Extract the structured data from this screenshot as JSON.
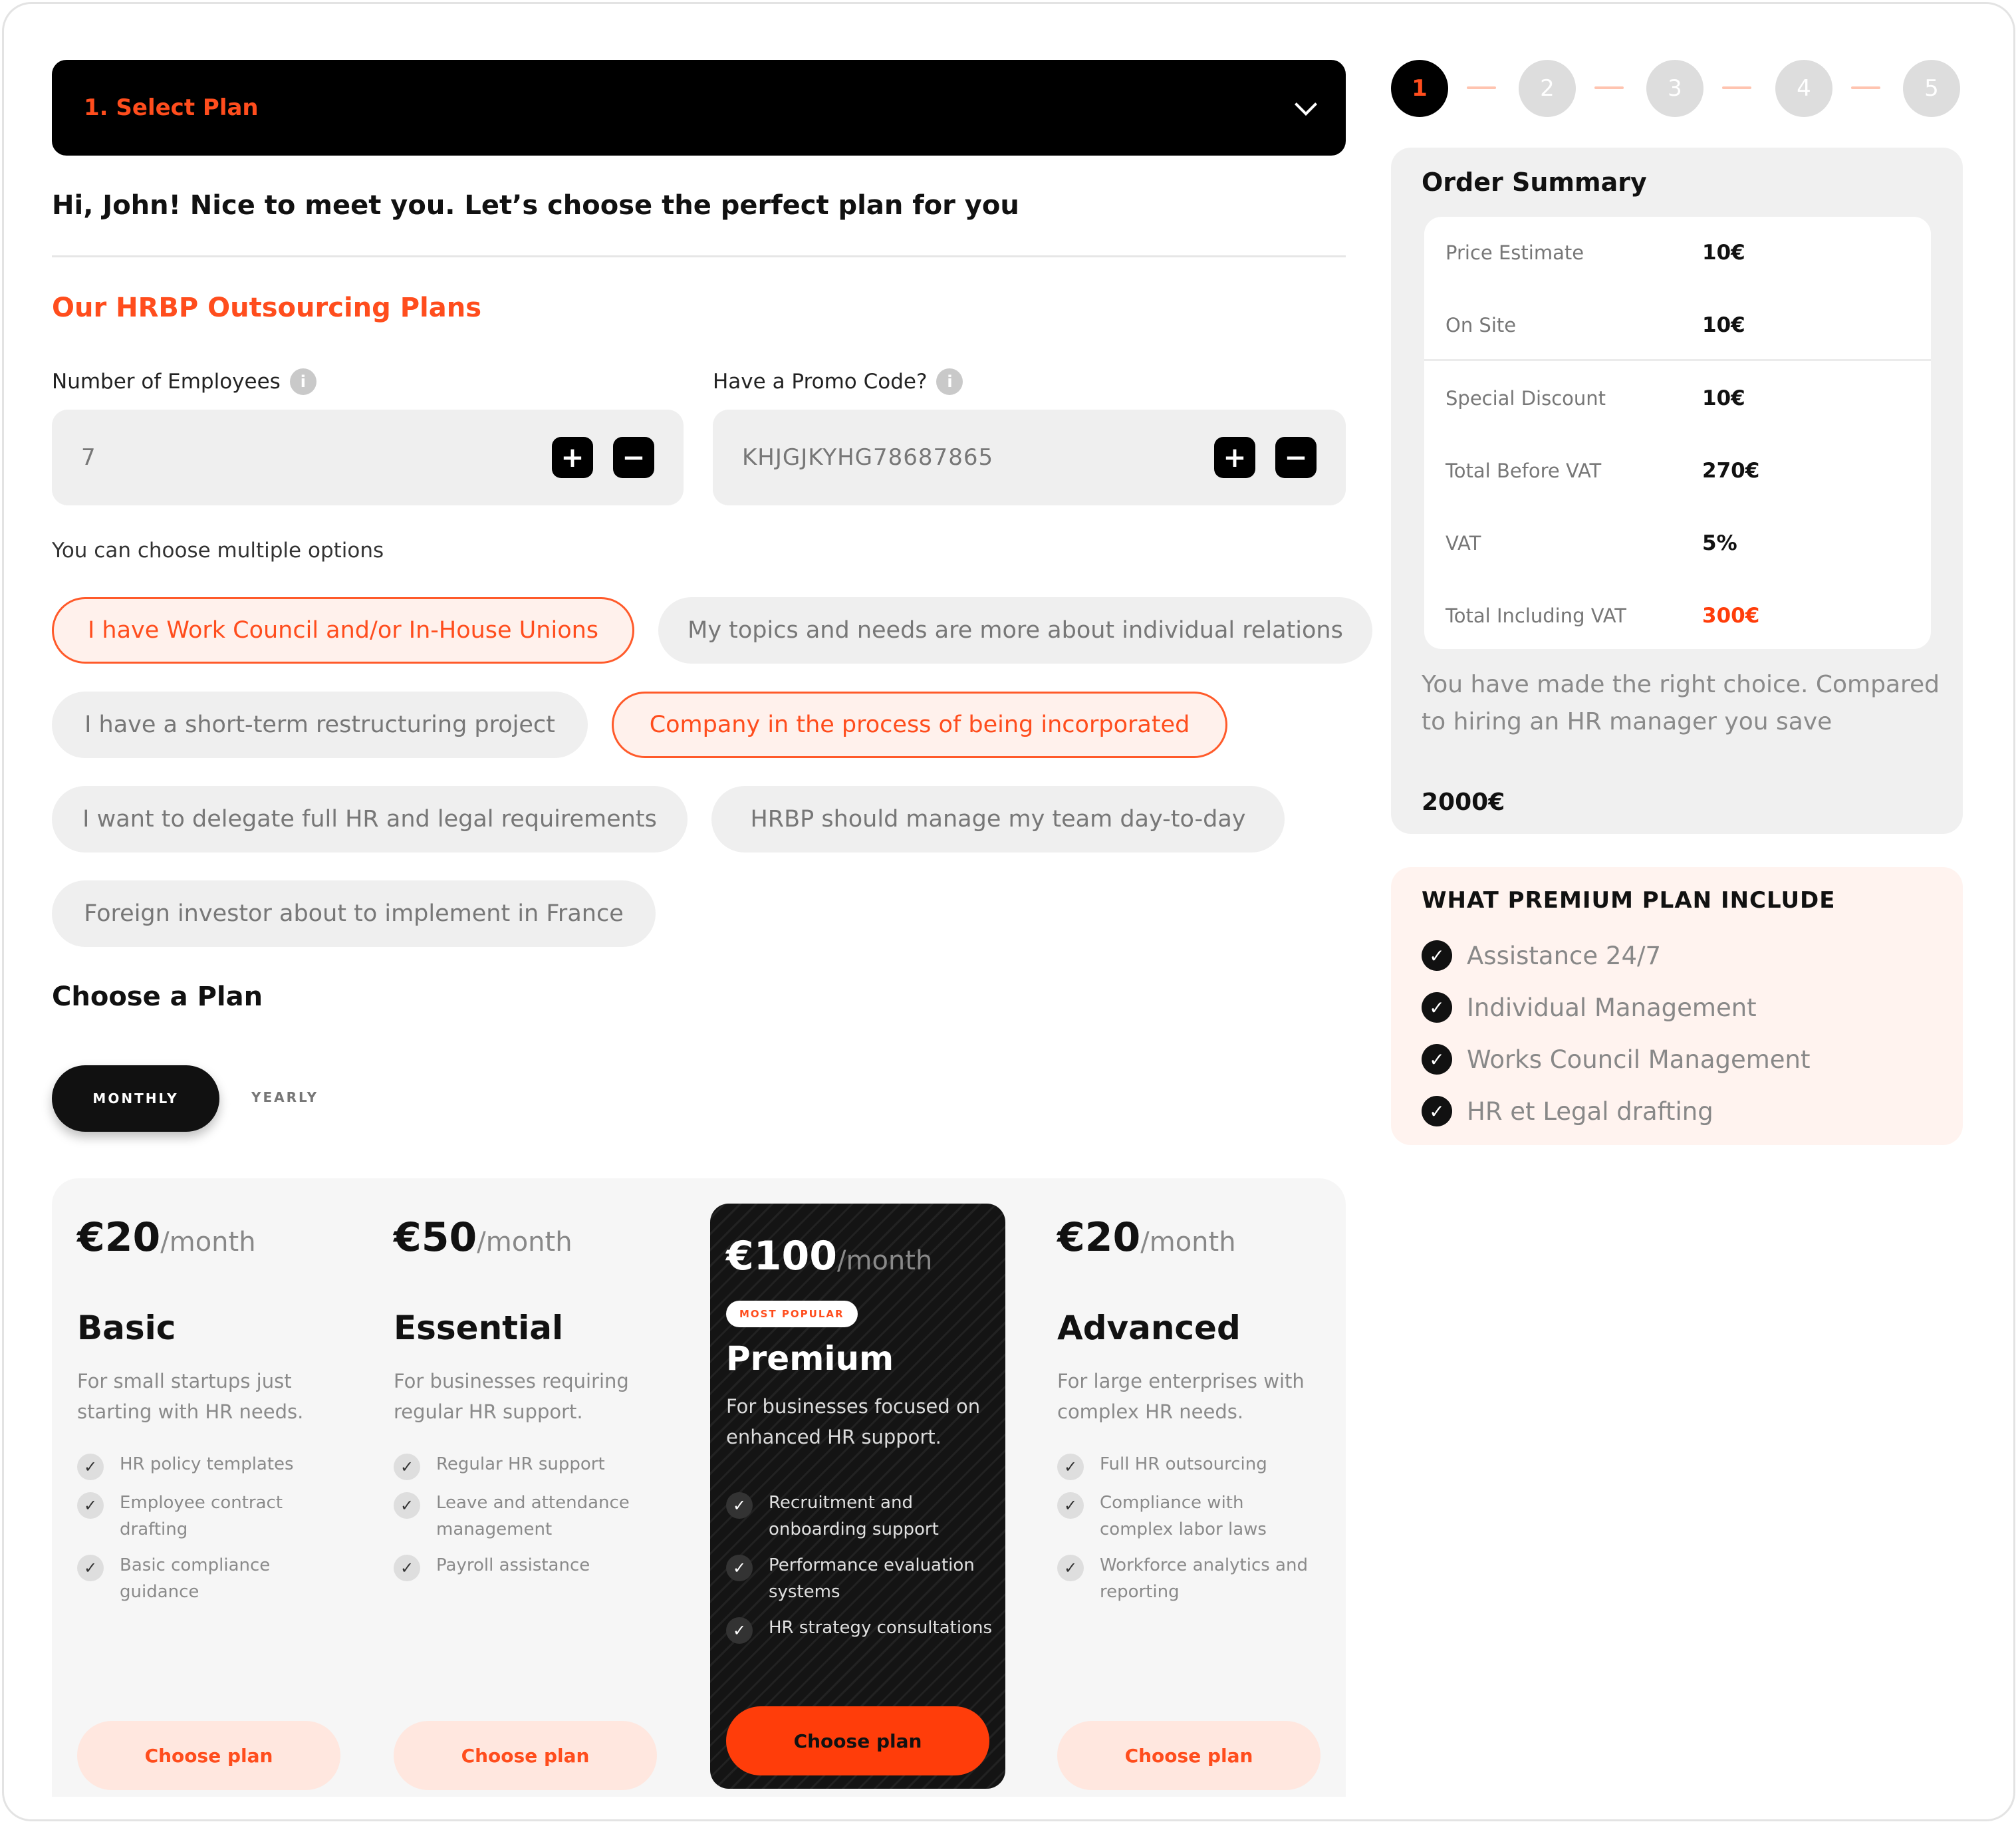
{
  "accordion": {
    "title": "1. Select Plan"
  },
  "greeting": "Hi, John! Nice to meet you. Let’s choose the perfect plan for you",
  "section_title": "Our HRBP Outsourcing Plans",
  "employees": {
    "label": "Number of Employees",
    "value": "7",
    "info_icon": "info-icon"
  },
  "promo": {
    "label": "Have a Promo Code?",
    "value": "KHJGJKYHG78687865",
    "info_icon": "info-icon"
  },
  "stepper": {
    "plus": "+",
    "minus": "−"
  },
  "options_hint": "You can choose multiple options",
  "options": [
    {
      "label": "I have Work Council and/or In-House Unions",
      "selected": true
    },
    {
      "label": "My topics and needs are more about individual relations",
      "selected": false
    },
    {
      "label": "I have a short-term restructuring project",
      "selected": false
    },
    {
      "label": "Company in the process of being incorporated",
      "selected": true
    },
    {
      "label": "I want to delegate full HR and legal requirements",
      "selected": false
    },
    {
      "label": "HRBP should manage my team day-to-day",
      "selected": false
    },
    {
      "label": "Foreign investor about to implement in France",
      "selected": false
    }
  ],
  "choose_plan_title": "Choose a Plan",
  "billing": {
    "monthly": "MONTHLY",
    "yearly": "YEARLY",
    "selected": "monthly"
  },
  "plans": [
    {
      "price": "€20",
      "per": "/month",
      "name": "Basic",
      "desc": "For small startups just starting with HR needs.",
      "features": [
        "HR policy templates",
        "Employee contract drafting",
        "Basic compliance guidance"
      ],
      "cta": "Choose plan"
    },
    {
      "price": "€50",
      "per": "/month",
      "name": "Essential",
      "desc": "For businesses requiring regular HR support.",
      "features": [
        "Regular HR support",
        "Leave and attendance management",
        "Payroll assistance"
      ],
      "cta": "Choose plan"
    },
    {
      "price": "€100",
      "per": "/month",
      "name": "Premium",
      "badge": "MOST POPULAR",
      "desc": "For businesses focused on enhanced HR support.",
      "features": [
        "Recruitment and onboarding support",
        "Performance evaluation systems",
        "HR strategy consultations"
      ],
      "cta": "Choose plan"
    },
    {
      "price": "€20",
      "per": "/month",
      "name": "Advanced",
      "desc": "For large enterprises with complex HR needs.",
      "features": [
        "Full HR outsourcing",
        "Compliance with complex labor laws",
        "Workforce analytics and reporting"
      ],
      "cta": "Choose plan"
    }
  ],
  "steps": [
    "1",
    "2",
    "3",
    "4",
    "5"
  ],
  "active_step": 1,
  "order_summary": {
    "title": "Order Summary",
    "rows": [
      {
        "label": "Price Estimate",
        "value": "10€"
      },
      {
        "label": "On Site",
        "value": "10€"
      },
      {
        "label": "Special Discount",
        "value": "10€"
      },
      {
        "label": "Total Before VAT",
        "value": "270€"
      },
      {
        "label": "VAT",
        "value": "5%"
      },
      {
        "label": "Total Including VAT",
        "value": "300€"
      }
    ],
    "note": "You have made the right choice. Compared to hiring an HR manager you save",
    "savings": "2000€"
  },
  "premium_includes": {
    "title": "WHAT PREMIUM PLAN INCLUDE",
    "items": [
      "Assistance 24/7",
      "Individual Management",
      "Works Council Management",
      "HR et Legal drafting"
    ]
  },
  "colors": {
    "accent": "#ff4d1d",
    "dark": "#000000",
    "chip_bg": "#efefef",
    "selected_bg": "#fff1ec"
  }
}
